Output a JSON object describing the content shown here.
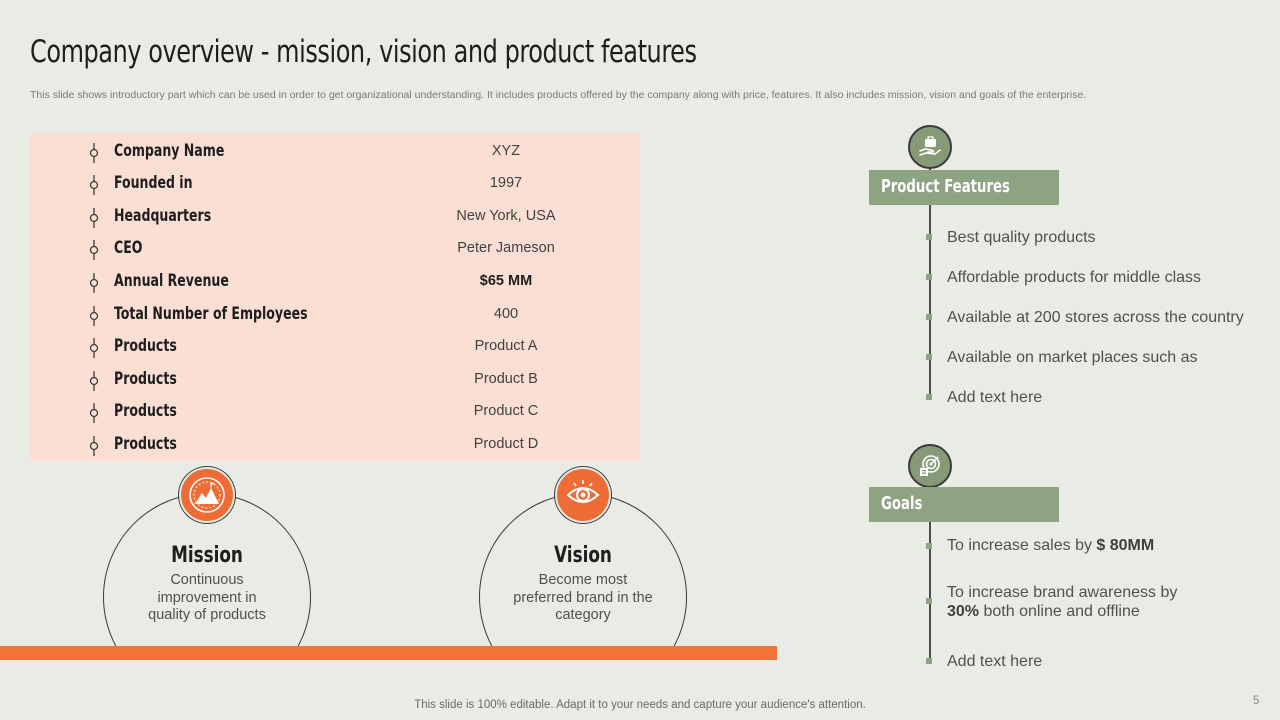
{
  "title": "Company overview - mission, vision and product features",
  "subtitle": "This slide shows introductory part which can be used in order to get organizational understanding. It includes products offered by the company along with price, features. It also includes mission, vision and goals of the enterprise.",
  "company_info": [
    {
      "label": "Company Name",
      "value": "XYZ"
    },
    {
      "label": "Founded in",
      "value": "1997"
    },
    {
      "label": "Headquarters",
      "value": "New York, USA"
    },
    {
      "label": "CEO",
      "value": "Peter Jameson"
    },
    {
      "label": "Annual Revenue",
      "value": "$65 MM"
    },
    {
      "label": "Total Number of Employees",
      "value": "400"
    },
    {
      "label": "Products",
      "value": "Product A"
    },
    {
      "label": "Products",
      "value": "Product B"
    },
    {
      "label": "Products",
      "value": "Product C"
    },
    {
      "label": "Products",
      "value": "Product D"
    }
  ],
  "mission": {
    "title": "Mission",
    "text": "Continuous improvement in quality of products",
    "icon": "mountain-peak-icon"
  },
  "vision": {
    "title": "Vision",
    "text": "Become most preferred brand in the category",
    "icon": "eye-icon"
  },
  "product_features": {
    "title": "Product Features",
    "icon": "hand-briefcase-icon",
    "items": [
      "Best quality products",
      "Affordable products for middle class",
      "Available at 200 stores across the country",
      "Available on market places such as",
      "Add text here"
    ]
  },
  "goals": {
    "title": "Goals",
    "icon": "target-icon",
    "item1_prefix": "To increase sales by ",
    "item1_bold": "$ 80MM",
    "item2_line1": "To increase brand awareness by",
    "item2_bold": "30%",
    "item2_rest": " both online and offline",
    "item3": "Add text here"
  },
  "footer": "This slide is 100% editable. Adapt it to your needs and capture your audience's attention.",
  "page_number": "5",
  "colors": {
    "background": "#e9ebe5",
    "panel": "#fcdfd4",
    "accent_orange": "#f07436",
    "accent_green": "#8ea382"
  }
}
